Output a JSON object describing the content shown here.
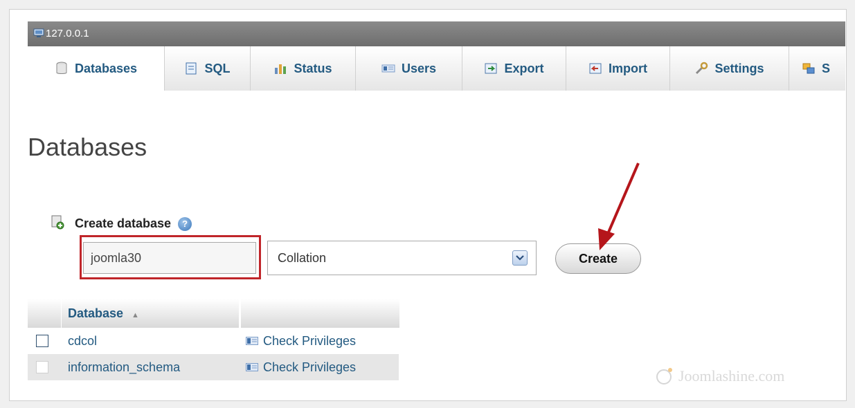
{
  "server": {
    "name": "127.0.0.1"
  },
  "tabs": [
    {
      "label": "Databases",
      "icon": "database-icon"
    },
    {
      "label": "SQL",
      "icon": "sql-icon"
    },
    {
      "label": "Status",
      "icon": "status-icon"
    },
    {
      "label": "Users",
      "icon": "users-icon"
    },
    {
      "label": "Export",
      "icon": "export-icon"
    },
    {
      "label": "Import",
      "icon": "import-icon"
    },
    {
      "label": "Settings",
      "icon": "settings-icon"
    },
    {
      "label": "S",
      "icon": "synchronize-icon"
    }
  ],
  "page": {
    "title": "Databases"
  },
  "create_db": {
    "label": "Create database",
    "name_value": "joomla30",
    "collation_value": "Collation",
    "button_label": "Create"
  },
  "table": {
    "header_database": "Database",
    "rows": [
      {
        "name": "cdcol",
        "action": "Check Privileges"
      },
      {
        "name": "information_schema",
        "action": "Check Privileges"
      }
    ]
  },
  "watermark": {
    "text": "Joomlashine.com"
  },
  "colors": {
    "accent_link": "#235a81",
    "highlight": "#c0252a",
    "server_bar": "#7a7a7a"
  }
}
